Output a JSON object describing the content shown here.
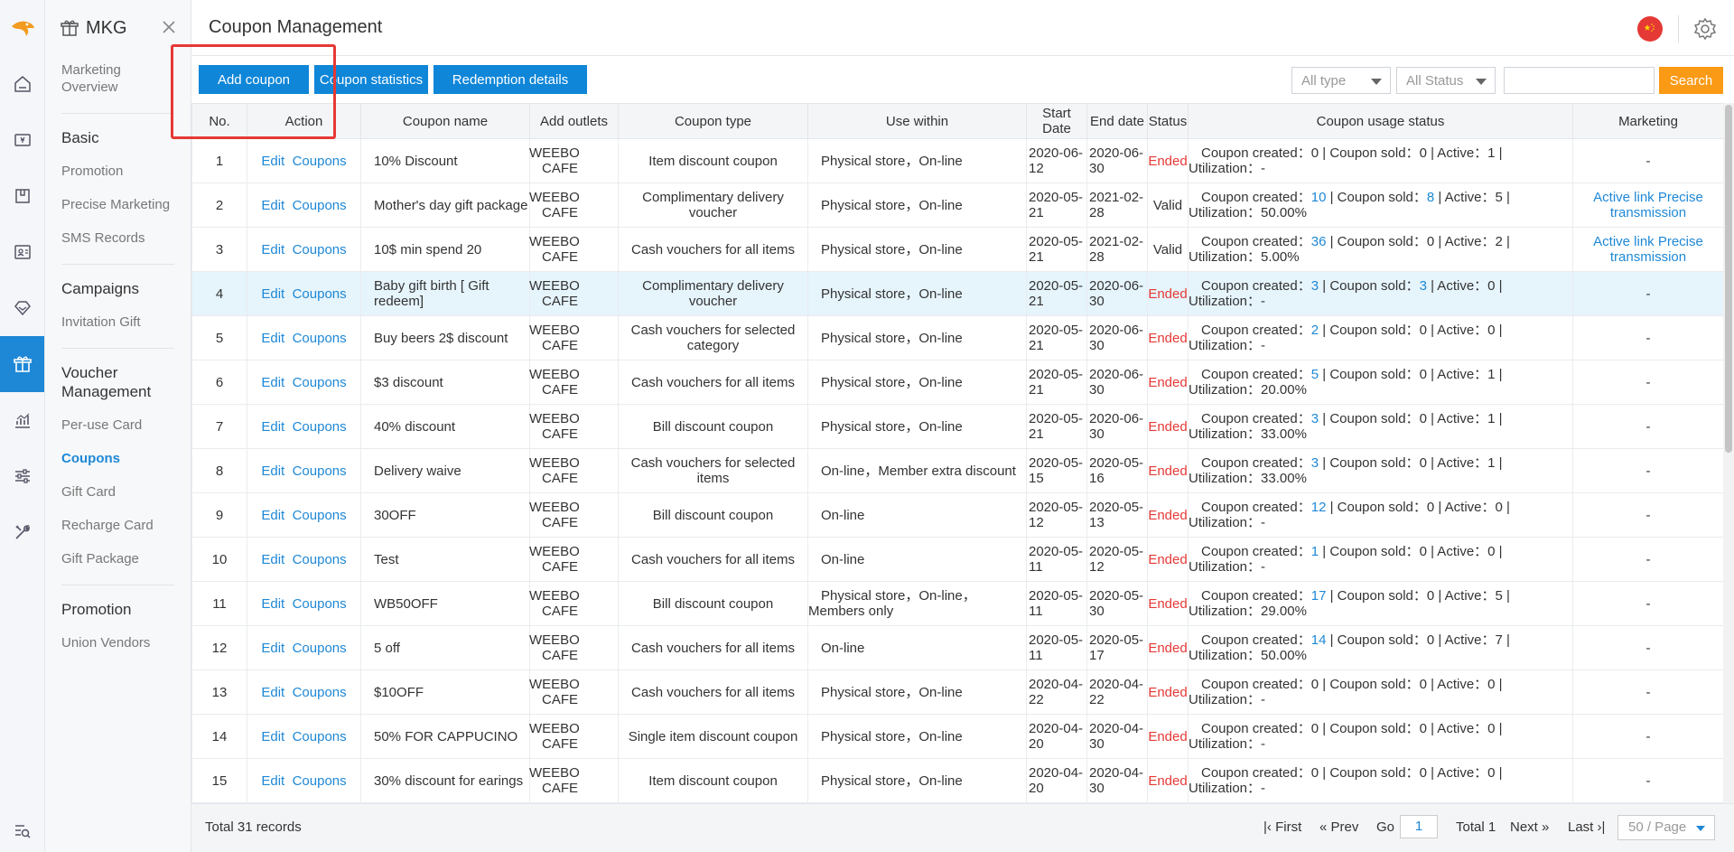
{
  "sidebar": {
    "title": "MKG",
    "sections": [
      {
        "group": "",
        "items": [
          {
            "label": "Marketing Overview",
            "active": false
          }
        ]
      },
      {
        "group": "Basic",
        "items": [
          {
            "label": "Promotion"
          },
          {
            "label": "Precise Marketing"
          },
          {
            "label": "SMS Records"
          }
        ]
      },
      {
        "group": "Campaigns",
        "items": [
          {
            "label": "Invitation Gift"
          }
        ]
      },
      {
        "group": "Voucher Management",
        "items": [
          {
            "label": "Per-use Card"
          },
          {
            "label": "Coupons",
            "active": true
          },
          {
            "label": "Gift Card"
          },
          {
            "label": "Recharge Card"
          },
          {
            "label": "Gift Package"
          }
        ]
      },
      {
        "group": "Promotion",
        "items": [
          {
            "label": "Union Vendors"
          }
        ]
      }
    ]
  },
  "header": {
    "title": "Coupon Management"
  },
  "toolbar": {
    "add_label": "Add coupon",
    "stats_label": "Coupon statistics",
    "redemption_label": "Redemption details",
    "type_select": "All type",
    "status_select": "All Status",
    "search_value": "",
    "search_label": "Search"
  },
  "table": {
    "columns": [
      "No.",
      "Action",
      "Coupon name",
      "Add outlets",
      "Coupon type",
      "Use within",
      "Start Date",
      "End date",
      "Status",
      "Coupon usage status",
      "Marketing"
    ],
    "action_edit": "Edit",
    "action_coupons": "Coupons",
    "rows": [
      {
        "no": "1",
        "name": "10% Discount",
        "outlet": "WEEBO CAFE",
        "type": "Item discount coupon",
        "use": "Physical store，On-line",
        "start": "2020-06-12",
        "end": "2020-06-30",
        "status": "Ended",
        "created": "0",
        "sold": "0",
        "active": "1",
        "util": "-",
        "marketing": "-"
      },
      {
        "no": "2",
        "name": "Mother's day gift package",
        "outlet": "WEEBO CAFE",
        "type": "Complimentary delivery voucher",
        "use": "Physical store，On-line",
        "start": "2020-05-21",
        "end": "2021-02-28",
        "status": "Valid",
        "created": "10",
        "sold": "8",
        "active": "5",
        "util": "50.00%",
        "marketing": "Active link  Precise transmission"
      },
      {
        "no": "3",
        "name": "10$ min spend 20",
        "outlet": "WEEBO CAFE",
        "type": "Cash vouchers for all items",
        "use": "Physical store，On-line",
        "start": "2020-05-21",
        "end": "2021-02-28",
        "status": "Valid",
        "created": "36",
        "sold": "0",
        "active": "2",
        "util": "5.00%",
        "marketing": "Active link  Precise transmission"
      },
      {
        "no": "4",
        "name": "Baby gift birth [ Gift redeem]",
        "outlet": "WEEBO CAFE",
        "type": "Complimentary delivery voucher",
        "use": "Physical store，On-line",
        "start": "2020-05-21",
        "end": "2020-06-30",
        "status": "Ended",
        "created": "3",
        "sold": "3",
        "active": "0",
        "util": "-",
        "marketing": "-"
      },
      {
        "no": "5",
        "name": "Buy beers 2$ discount",
        "outlet": "WEEBO CAFE",
        "type": "Cash vouchers for selected category",
        "use": "Physical store，On-line",
        "start": "2020-05-21",
        "end": "2020-06-30",
        "status": "Ended",
        "created": "2",
        "sold": "0",
        "active": "0",
        "util": "-",
        "marketing": "-"
      },
      {
        "no": "6",
        "name": "$3 discount",
        "outlet": "WEEBO CAFE",
        "type": "Cash vouchers for all items",
        "use": "Physical store，On-line",
        "start": "2020-05-21",
        "end": "2020-06-30",
        "status": "Ended",
        "created": "5",
        "sold": "0",
        "active": "1",
        "util": "20.00%",
        "marketing": "-"
      },
      {
        "no": "7",
        "name": "40% discount",
        "outlet": "WEEBO CAFE",
        "type": "Bill discount coupon",
        "use": "Physical store，On-line",
        "start": "2020-05-21",
        "end": "2020-06-30",
        "status": "Ended",
        "created": "3",
        "sold": "0",
        "active": "1",
        "util": "33.00%",
        "marketing": "-"
      },
      {
        "no": "8",
        "name": "Delivery waive",
        "outlet": "WEEBO CAFE",
        "type": "Cash vouchers for selected items",
        "use": "On-line，Member extra discount",
        "start": "2020-05-15",
        "end": "2020-05-16",
        "status": "Ended",
        "created": "3",
        "sold": "0",
        "active": "1",
        "util": "33.00%",
        "marketing": "-"
      },
      {
        "no": "9",
        "name": "30OFF",
        "outlet": "WEEBO CAFE",
        "type": "Bill discount coupon",
        "use": "On-line",
        "start": "2020-05-12",
        "end": "2020-05-13",
        "status": "Ended",
        "created": "12",
        "sold": "0",
        "active": "0",
        "util": "-",
        "marketing": "-"
      },
      {
        "no": "10",
        "name": "Test",
        "outlet": "WEEBO CAFE",
        "type": "Cash vouchers for all items",
        "use": "On-line",
        "start": "2020-05-11",
        "end": "2020-05-12",
        "status": "Ended",
        "created": "1",
        "sold": "0",
        "active": "0",
        "util": "-",
        "marketing": "-"
      },
      {
        "no": "11",
        "name": "WB50OFF",
        "outlet": "WEEBO CAFE",
        "type": "Bill discount coupon",
        "use": "Physical store，On-line，Members only",
        "start": "2020-05-11",
        "end": "2020-05-30",
        "status": "Ended",
        "created": "17",
        "sold": "0",
        "active": "5",
        "util": "29.00%",
        "marketing": "-"
      },
      {
        "no": "12",
        "name": "5 off",
        "outlet": "WEEBO CAFE",
        "type": "Cash vouchers for all items",
        "use": "On-line",
        "start": "2020-05-11",
        "end": "2020-05-17",
        "status": "Ended",
        "created": "14",
        "sold": "0",
        "active": "7",
        "util": "50.00%",
        "marketing": "-"
      },
      {
        "no": "13",
        "name": "$10OFF",
        "outlet": "WEEBO CAFE",
        "type": "Cash vouchers for all items",
        "use": "Physical store，On-line",
        "start": "2020-04-22",
        "end": "2020-04-22",
        "status": "Ended",
        "created": "0",
        "sold": "0",
        "active": "0",
        "util": "-",
        "marketing": "-"
      },
      {
        "no": "14",
        "name": "50% FOR CAPPUCINO",
        "outlet": "WEEBO CAFE",
        "type": "Single item discount coupon",
        "use": "Physical store，On-line",
        "start": "2020-04-20",
        "end": "2020-04-30",
        "status": "Ended",
        "created": "0",
        "sold": "0",
        "active": "0",
        "util": "-",
        "marketing": "-"
      },
      {
        "no": "15",
        "name": "30% discount for earings",
        "outlet": "WEEBO CAFE",
        "type": "Item discount coupon",
        "use": "Physical store，On-line",
        "start": "2020-04-20",
        "end": "2020-04-30",
        "status": "Ended",
        "created": "0",
        "sold": "0",
        "active": "0",
        "util": "-",
        "marketing": "-"
      }
    ]
  },
  "footer": {
    "total": "Total 31 records",
    "first": "First",
    "prev": "Prev",
    "go": "Go",
    "page_input": "1",
    "total_pages": "Total 1",
    "next": "Next",
    "last": "Last",
    "per_page": "50 / Page"
  },
  "colors": {
    "accent": "#1e88d6",
    "ended": "#e53935",
    "search": "#fa9a15",
    "highlight": "#e53935"
  }
}
